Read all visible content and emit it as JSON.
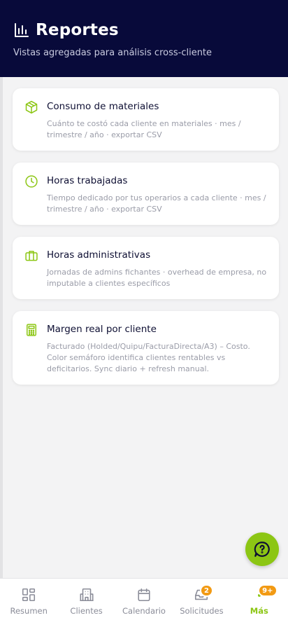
{
  "header": {
    "title": "Reportes",
    "subtitle": "Vistas agregadas para análisis cross-cliente",
    "title_icon": "bar-chart-icon"
  },
  "reports": [
    {
      "icon": "box-icon",
      "title": "Consumo de materiales",
      "description": "Cuánto te costó cada cliente en materiales · mes / trimestre / año · exportar CSV"
    },
    {
      "icon": "clock-icon",
      "title": "Horas trabajadas",
      "description": "Tiempo dedicado por tus operarios a cada cliente · mes / trimestre / año · exportar CSV"
    },
    {
      "icon": "briefcase-icon",
      "title": "Horas administrativas",
      "description": "Jornadas de admins fichantes · overhead de empresa, no imputable a clientes específicos"
    },
    {
      "icon": "calculator-icon",
      "title": "Margen real por cliente",
      "description": "Facturado (Holded/Quipu/FacturaDirecta/A3) – Costo. Color semáforo identifica clientes rentables vs deficitarios. Sync diario + refresh manual."
    }
  ],
  "fab": {
    "icon": "chat-help-icon"
  },
  "nav": {
    "items": [
      {
        "label": "Resumen",
        "icon": "dashboard-icon",
        "badge": ""
      },
      {
        "label": "Clientes",
        "icon": "building-icon",
        "badge": ""
      },
      {
        "label": "Calendario",
        "icon": "calendar-icon",
        "badge": ""
      },
      {
        "label": "Solicitudes",
        "icon": "inbox-icon",
        "badge": "2"
      },
      {
        "label": "Más",
        "icon": "more-icon",
        "badge": "9+"
      }
    ],
    "active": "Más"
  },
  "colors": {
    "header_bg": "#080a3a",
    "accent": "#8cc614",
    "badge": "#f29a13",
    "background": "#f3f3f4"
  }
}
